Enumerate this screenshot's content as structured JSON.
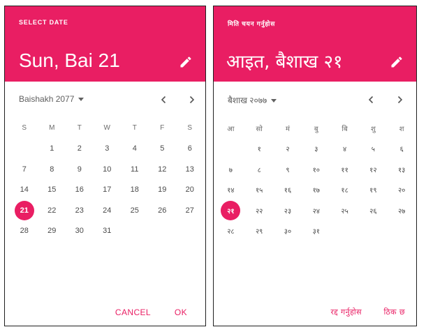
{
  "colors": {
    "accent": "#e91e63",
    "header_text": "#ffffff",
    "day_text": "#4a4a4a"
  },
  "english": {
    "select_label": "SELECT DATE",
    "date_title": "Sun, Bai 21",
    "month_label": "Baishakh 2077",
    "weekdays": [
      "S",
      "M",
      "T",
      "W",
      "T",
      "F",
      "S"
    ],
    "days": [
      "1",
      "2",
      "3",
      "4",
      "5",
      "6",
      "7",
      "8",
      "9",
      "10",
      "11",
      "12",
      "13",
      "14",
      "15",
      "16",
      "17",
      "18",
      "19",
      "20",
      "21",
      "22",
      "23",
      "24",
      "25",
      "26",
      "27",
      "28",
      "29",
      "30",
      "31"
    ],
    "leading_blanks": 1,
    "selected_day": "21",
    "cancel_label": "CANCEL",
    "ok_label": "OK",
    "icons": {
      "edit": "pencil-icon",
      "prev": "chevron-left-icon",
      "next": "chevron-right-icon",
      "dropdown": "caret-down-icon"
    }
  },
  "nepali": {
    "select_label": "मिति चयन गर्नुहोस",
    "date_title": "आइत, बैशाख २१",
    "month_label": "बैशाख २०७७",
    "weekdays": [
      "आ",
      "सो",
      "मं",
      "बु",
      "बि",
      "शु",
      "श"
    ],
    "days": [
      "१",
      "२",
      "३",
      "४",
      "५",
      "६",
      "७",
      "८",
      "९",
      "१०",
      "११",
      "१२",
      "१३",
      "१४",
      "१५",
      "१६",
      "१७",
      "१८",
      "१९",
      "२०",
      "२१",
      "२२",
      "२३",
      "२४",
      "२५",
      "२६",
      "२७",
      "२८",
      "२९",
      "३०",
      "३१"
    ],
    "leading_blanks": 1,
    "selected_day": "२१",
    "cancel_label": "रद्द गर्नुहोस",
    "ok_label": "ठिक छ",
    "icons": {
      "edit": "pencil-icon",
      "prev": "chevron-left-icon",
      "next": "chevron-right-icon",
      "dropdown": "caret-down-icon"
    }
  }
}
